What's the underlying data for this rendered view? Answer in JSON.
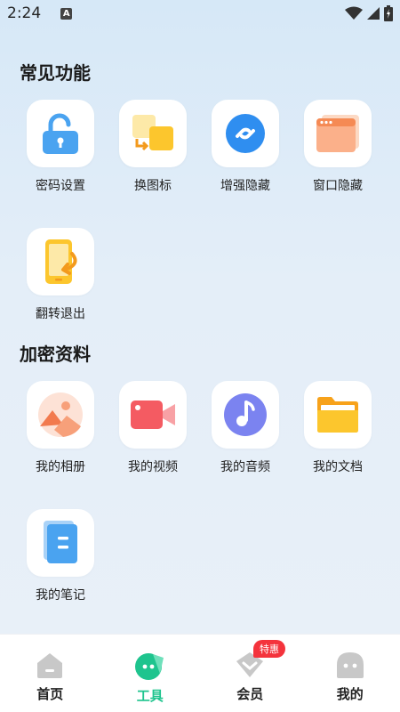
{
  "status_bar": {
    "time": "2:24",
    "badge": "A"
  },
  "sections": [
    {
      "title": "常见功能",
      "items": [
        {
          "label": "密码设置",
          "icon": "lock-icon"
        },
        {
          "label": "换图标",
          "icon": "swap-icon"
        },
        {
          "label": "增强隐藏",
          "icon": "link-icon"
        },
        {
          "label": "窗口隐藏",
          "icon": "window-icon"
        },
        {
          "label": "翻转退出",
          "icon": "flip-phone-icon"
        }
      ]
    },
    {
      "title": "加密资料",
      "items": [
        {
          "label": "我的相册",
          "icon": "photo-icon"
        },
        {
          "label": "我的视频",
          "icon": "video-icon"
        },
        {
          "label": "我的音频",
          "icon": "music-icon"
        },
        {
          "label": "我的文档",
          "icon": "folder-icon"
        },
        {
          "label": "我的笔记",
          "icon": "note-icon"
        }
      ]
    }
  ],
  "tabbar": {
    "items": [
      {
        "label": "首页",
        "icon": "home-icon"
      },
      {
        "label": "工具",
        "icon": "tools-icon",
        "active": true
      },
      {
        "label": "会员",
        "icon": "member-icon",
        "badge": "特惠"
      },
      {
        "label": "我的",
        "icon": "profile-icon"
      }
    ]
  },
  "colors": {
    "accent": "#1ec48e",
    "badge": "#f4333c"
  }
}
